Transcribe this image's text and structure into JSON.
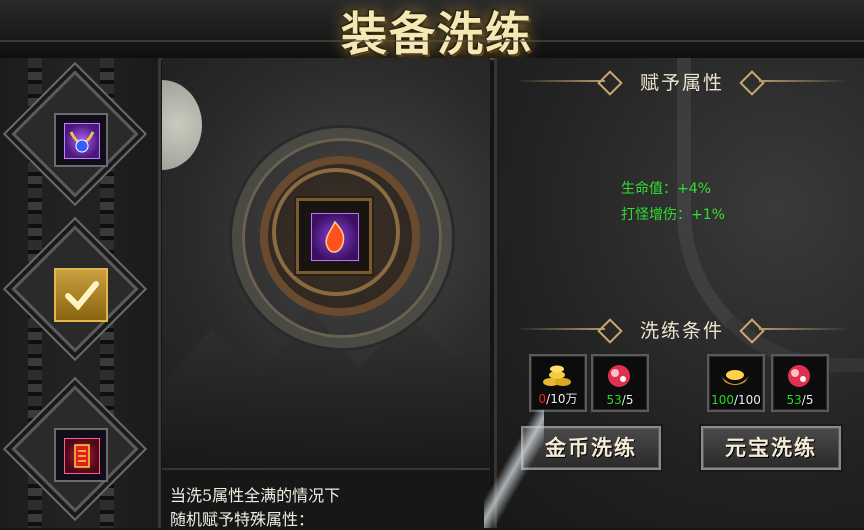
{
  "title": "装备洗练",
  "left_slots": [
    {
      "name": "necklace-gem",
      "selected": false
    },
    {
      "name": "checked",
      "selected": true
    },
    {
      "name": "red-talisman",
      "selected": false
    }
  ],
  "description": {
    "line1": "当洗5属性全满的情况下",
    "line2": "随机赋予特殊属性："
  },
  "attributes": {
    "header": "赋予属性",
    "items": [
      "生命值：+4%",
      "打怪增伤：+1%"
    ]
  },
  "conditions": {
    "header": "洗练条件",
    "gold": {
      "have": "0",
      "need": "/10万",
      "icon": "gold-coins-icon"
    },
    "stone_a": {
      "have": "53",
      "need": "/5",
      "icon": "refine-stone-icon"
    },
    "yuanbao": {
      "have": "100",
      "need": "/100",
      "icon": "gold-ingot-icon"
    },
    "stone_b": {
      "have": "53",
      "need": "/5",
      "icon": "refine-stone-icon"
    }
  },
  "buttons": {
    "gold_refine": "金币洗练",
    "yuanbao_refine": "元宝洗练"
  },
  "colors": {
    "attr_green": "#2fe02f",
    "insufficient": "#ff2020",
    "sufficient": "#22e022"
  }
}
